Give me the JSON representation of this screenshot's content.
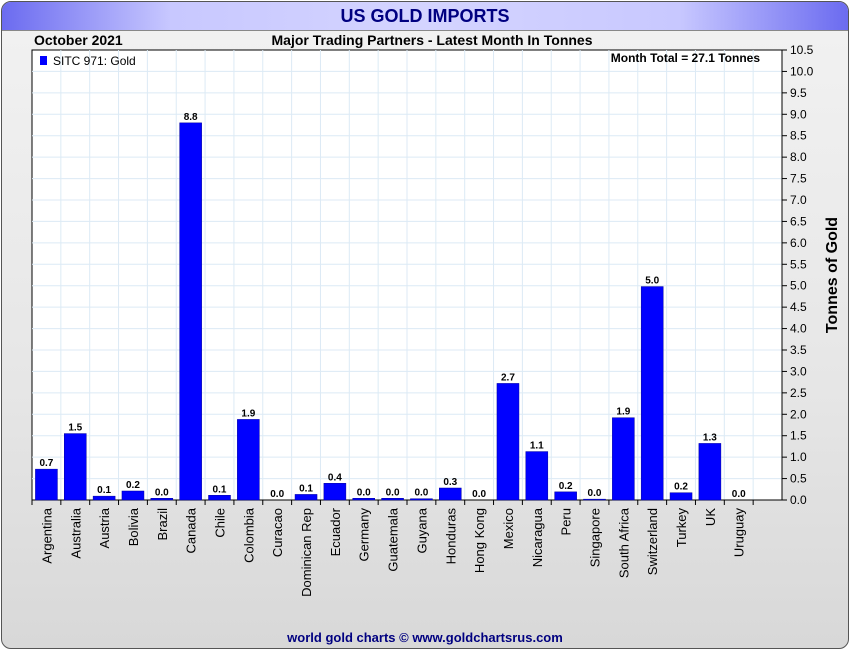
{
  "header": {
    "title": "US GOLD IMPORTS",
    "period": "October 2021",
    "subtitle": "Major Trading Partners - Latest Month In Tonnes"
  },
  "footer": "world gold charts © www.goldchartsrus.com",
  "chart_data": {
    "type": "bar",
    "title": "US GOLD IMPORTS",
    "subtitle": "Major Trading Partners - Latest Month In Tonnes",
    "ylabel": "Tonnes of Gold",
    "xlabel": "",
    "annotation": "Month Total = 27.1 Tonnes",
    "legend": {
      "entries": [
        "SITC 971: Gold"
      ],
      "placement": "top-left",
      "color": "#0000ff"
    },
    "ylim": [
      0,
      10.5
    ],
    "yticks": [
      "0.0",
      "0.5",
      "1.0",
      "1.5",
      "2.0",
      "2.5",
      "3.0",
      "3.5",
      "4.0",
      "4.5",
      "5.0",
      "5.5",
      "6.0",
      "6.5",
      "7.0",
      "7.5",
      "8.0",
      "8.5",
      "9.0",
      "9.5",
      "10.0",
      "10.5"
    ],
    "grid": true,
    "bar_color": "#0000ff",
    "categories": [
      "Argentina",
      "Australia",
      "Austria",
      "Bolivia",
      "Brazil",
      "Canada",
      "Chile",
      "Colombia",
      "Curacao",
      "Dominican Rep",
      "Ecuador",
      "Germany",
      "Guatemala",
      "Guyana",
      "Honduras",
      "Hong Kong",
      "Mexico",
      "Nicaragua",
      "Peru",
      "Singapore",
      "South Africa",
      "Switzerland",
      "Turkey",
      "UK",
      "Uruguay"
    ],
    "values": [
      0.72,
      1.55,
      0.09,
      0.21,
      0.04,
      8.8,
      0.11,
      1.88,
      0.0,
      0.13,
      0.39,
      0.04,
      0.04,
      0.03,
      0.28,
      0.0,
      2.72,
      1.13,
      0.19,
      0.02,
      1.92,
      4.98,
      0.17,
      1.32,
      0.0
    ],
    "labels": [
      "0.7",
      "1.5",
      "0.1",
      "0.2",
      "0.0",
      "8.8",
      "0.1",
      "1.9",
      "0.0",
      "0.1",
      "0.4",
      "0.0",
      "0.0",
      "0.0",
      "0.3",
      "0.0",
      "2.7",
      "1.1",
      "0.2",
      "0.0",
      "1.9",
      "5.0",
      "0.2",
      "1.3",
      "0.0"
    ]
  }
}
